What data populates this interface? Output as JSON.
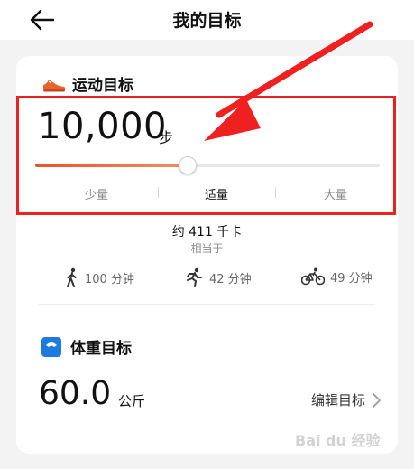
{
  "header": {
    "title": "我的目标",
    "back_icon": "arrow-left-icon"
  },
  "exercise_goal": {
    "section_title": "运动目标",
    "icon": "sneaker-icon",
    "steps_value": "10,000",
    "steps_unit": "步",
    "slider": {
      "level_fraction": 0.44,
      "options": [
        "少量",
        "适量",
        "大量"
      ],
      "selected": "适量"
    },
    "calories": "约 411 千卡",
    "equivalent_label": "相当于",
    "activities": [
      {
        "icon": "walking-icon",
        "label": "100 分钟"
      },
      {
        "icon": "running-icon",
        "label": "42 分钟"
      },
      {
        "icon": "cycling-icon",
        "label": "49 分钟"
      }
    ]
  },
  "weight_goal": {
    "section_title": "体重目标",
    "icon": "scale-icon",
    "value": "60.0",
    "unit": "公斤",
    "edit_label": "编辑目标"
  },
  "annotation": {
    "color": "#ee2020"
  },
  "accent_color": "#e7532a",
  "watermark": "Bai du 经验"
}
